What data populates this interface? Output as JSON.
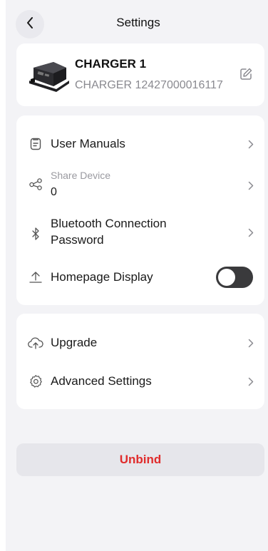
{
  "header": {
    "title": "Settings",
    "back_icon": "chevron-left-icon"
  },
  "device": {
    "name": "CHARGER 1",
    "serial": "CHARGER 12427000016117",
    "image": "charger-device-image",
    "edit_icon": "edit-pencil-icon"
  },
  "main_section": {
    "user_manuals": {
      "label": "User Manuals",
      "icon": "clipboard-icon"
    },
    "share_device": {
      "label": "Share Device",
      "value": "0",
      "icon": "share-nodes-icon"
    },
    "bluetooth": {
      "label_line1": "Bluetooth Connection",
      "label_line2": "Password",
      "icon": "bluetooth-icon"
    },
    "homepage_display": {
      "label": "Homepage Display",
      "icon": "upload-arrow-icon",
      "toggle_on": false
    }
  },
  "second_section": {
    "upgrade": {
      "label": "Upgrade",
      "icon": "cloud-upload-icon"
    },
    "advanced": {
      "label": "Advanced Settings",
      "icon": "gear-icon"
    }
  },
  "unbind": {
    "label": "Unbind",
    "color": "#e02c2c"
  }
}
